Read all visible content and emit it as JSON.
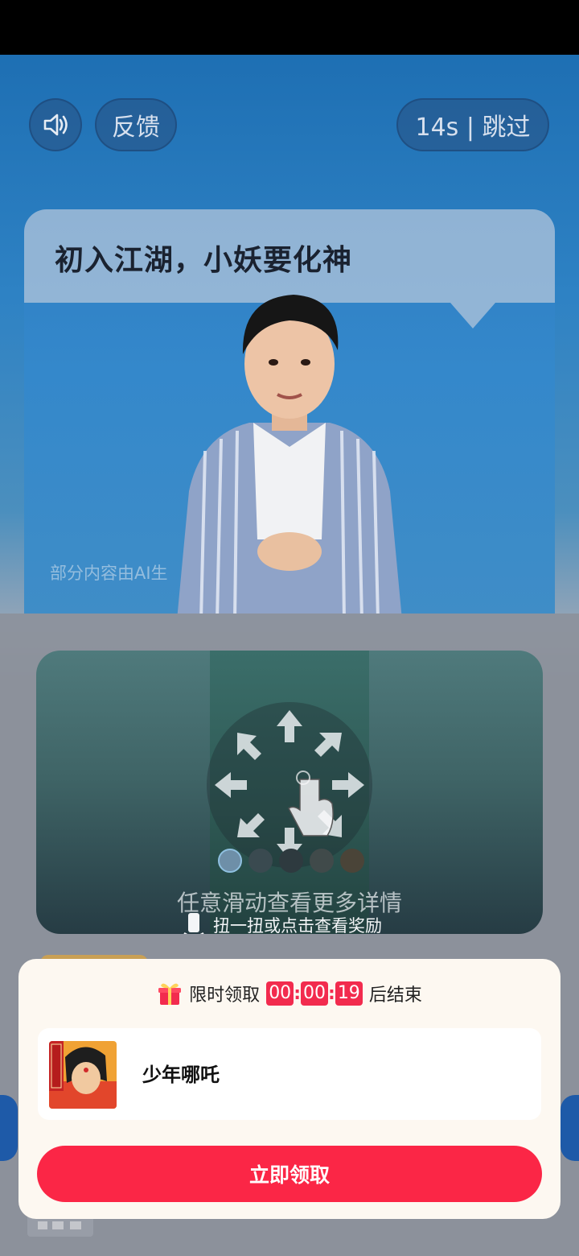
{
  "top_controls": {
    "sound_icon": "speaker-icon",
    "feedback_label": "反馈",
    "skip_label": "14s | 跳过"
  },
  "video": {
    "title": "初入江湖，小妖要化神",
    "ai_note": "部分内容由AI生"
  },
  "swipe_card": {
    "hint": "任意滑动查看更多详情",
    "twist_hint": "扭一扭或点击查看奖励"
  },
  "reward": {
    "limited_label": "限时领取",
    "hours": "00",
    "minutes": "00",
    "seconds": "19",
    "ends_label": "后结束",
    "app_name": "少年哪吒",
    "claim_label": "立即领取"
  },
  "colors": {
    "accent": "#fb2646",
    "timer": "#f22b4e"
  }
}
